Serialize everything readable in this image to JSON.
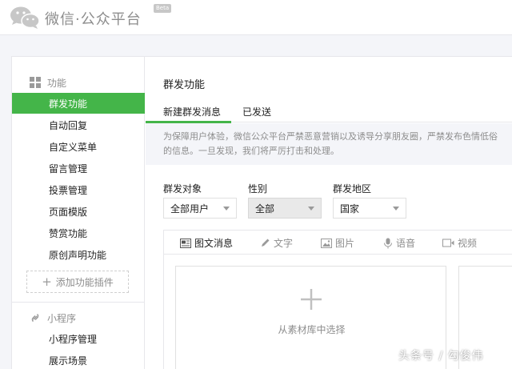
{
  "header": {
    "brand": "微信·公众平台",
    "beta": "Beta"
  },
  "sidebar": {
    "groups": [
      {
        "title": "功能",
        "icon": "grid-icon",
        "items": [
          "群发功能",
          "自动回复",
          "自定义菜单",
          "留言管理",
          "投票管理",
          "页面模版",
          "赞赏功能",
          "原创声明功能"
        ],
        "active_index": 0
      },
      {
        "title": "小程序",
        "icon": "link-icon",
        "items": [
          "小程序管理",
          "展示场景"
        ]
      }
    ],
    "add_plugin_label": "添加功能插件"
  },
  "main": {
    "title": "群发功能",
    "tabs": [
      {
        "label": "新建群发消息",
        "active": true
      },
      {
        "label": "已发送",
        "active": false
      }
    ],
    "notice_lines": [
      "为保障用户体验，微信公众平台严禁恶意营销以及诱导分享朋友圈，严禁发布色情低俗",
      "的信息。一旦发现，我们将严厉打击和处理。"
    ],
    "filters": [
      {
        "label": "群发对象",
        "value": "全部用户"
      },
      {
        "label": "性别",
        "value": "全部"
      },
      {
        "label": "群发地区",
        "value": "国家"
      }
    ],
    "editor_tabs": [
      {
        "label": "图文消息",
        "icon": "article-icon"
      },
      {
        "label": "文字",
        "icon": "pen-icon"
      },
      {
        "label": "图片",
        "icon": "image-icon"
      },
      {
        "label": "语音",
        "icon": "mic-icon"
      },
      {
        "label": "视频",
        "icon": "video-icon"
      }
    ],
    "upload_label": "从素材库中选择"
  },
  "watermark": "头条号 / 勾俊伟",
  "colors": {
    "accent": "#44b549",
    "background": "#f4f5f9",
    "muted_text": "#8d8d8d"
  }
}
